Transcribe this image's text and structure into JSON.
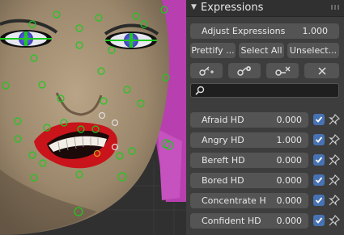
{
  "panel": {
    "title": "Expressions",
    "adjust": {
      "label": "Adjust Expressions",
      "value": "1.000"
    },
    "buttons": {
      "prettify": "Prettify ...",
      "select_all": "Select All",
      "unselect": "Unselect..."
    },
    "tool_icons": [
      "key-add-icon",
      "key-gear-icon",
      "key-remove-icon",
      "close-icon"
    ],
    "search": {
      "value": "",
      "placeholder": ""
    },
    "expressions": [
      {
        "label": "Afraid HD",
        "value": "0.000",
        "checked": true
      },
      {
        "label": "Angry HD",
        "value": "1.000",
        "checked": true
      },
      {
        "label": "Bereft HD",
        "value": "0.000",
        "checked": true
      },
      {
        "label": "Bored HD",
        "value": "0.000",
        "checked": true
      },
      {
        "label": "Concentrate H",
        "value": "0.000",
        "checked": true
      },
      {
        "label": "Confident HD",
        "value": "0.000",
        "checked": true
      }
    ]
  },
  "colors": {
    "accent": "#4772b3",
    "panel_bg": "#3d3d3d",
    "control_bg": "#545454",
    "rig_control": "#1ec81e"
  }
}
